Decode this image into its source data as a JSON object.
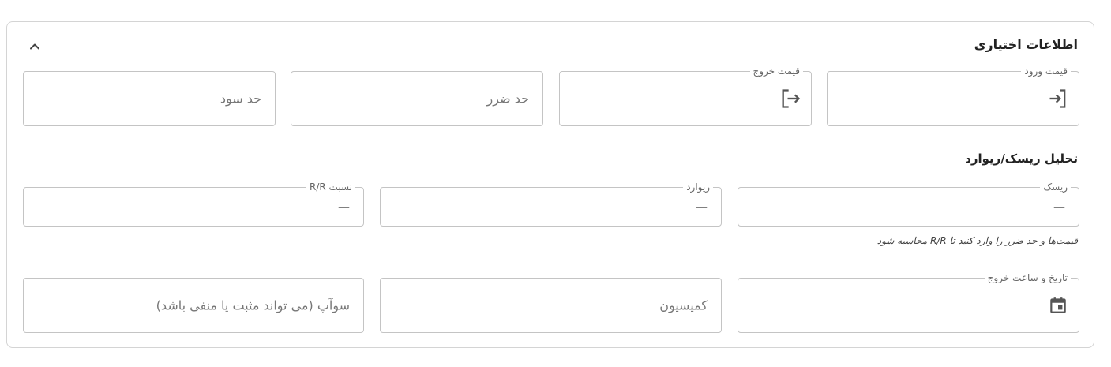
{
  "section": {
    "title": "اطلاعات اختیاری"
  },
  "prices": {
    "entry_label": "قیمت ورود",
    "exit_label": "قیمت خروج",
    "stop_loss_placeholder": "حد ضرر",
    "take_profit_placeholder": "حد سود"
  },
  "risk_reward": {
    "title": "تحلیل ریسک/ریوارد",
    "risk_label": "ریسک",
    "risk_value": "—",
    "reward_label": "ریوارد",
    "reward_value": "—",
    "ratio_label": "نسبت R/R",
    "ratio_value": "—",
    "hint": "قیمت‌ها و حد ضرر را وارد کنید تا R/R محاسبه شود"
  },
  "extra": {
    "exit_datetime_label": "تاریخ و ساعت خروج",
    "commission_placeholder": "کمیسیون",
    "swap_placeholder": "سوآپ (می تواند مثبت یا منفی باشد)"
  },
  "icons": {
    "collapse": "chevron-up-icon",
    "entry": "login-icon",
    "exit": "logout-icon",
    "calendar": "calendar-icon"
  },
  "colors": {
    "border": "#c4c4c4",
    "icon": "#555555",
    "text": "#222222"
  }
}
